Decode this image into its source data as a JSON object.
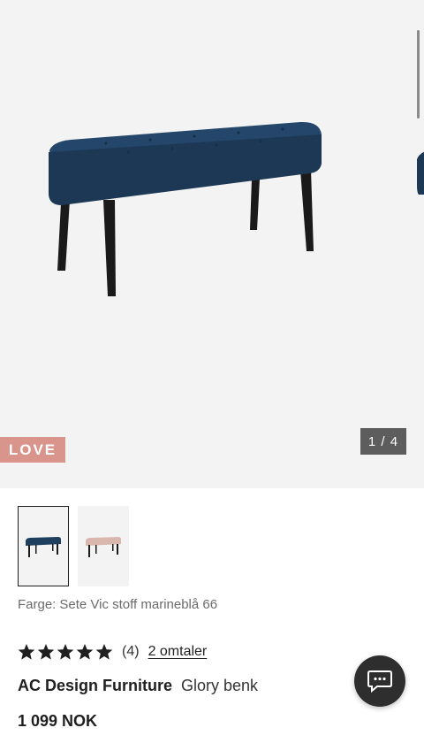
{
  "gallery": {
    "badge": "LOVE",
    "counter": "1 / 4",
    "main_image_icon": "bench-navy-image",
    "thumbnails": [
      {
        "icon": "bench-navy-thumbnail",
        "selected": true
      },
      {
        "icon": "bench-pink-thumbnail",
        "selected": false
      }
    ]
  },
  "product": {
    "color_label": "Farge:",
    "color_value": "Sete Vic stoff marineblå 66",
    "rating": 5,
    "rating_count": "(4)",
    "reviews_link": "2 omtaler",
    "brand": "AC Design Furniture",
    "name": "Glory benk",
    "price": "1 099 NOK"
  },
  "chat": {
    "icon": "chat-icon"
  },
  "colors": {
    "badge_bg": "#d9958c",
    "counter_bg": "#5d5d5d",
    "gallery_bg": "#f3f3f3",
    "bench_navy": "#1e3f5e",
    "bench_pink": "#d9b7ad",
    "chat_bg": "#2e2e2e"
  }
}
